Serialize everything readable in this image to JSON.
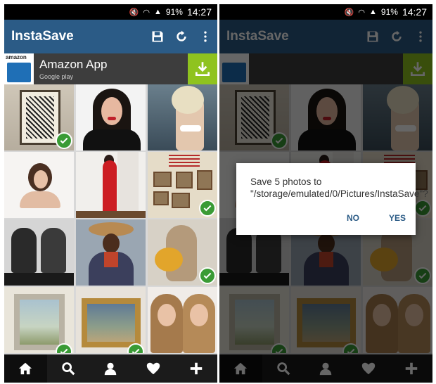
{
  "status_bar": {
    "battery": "91%",
    "time": "14:27"
  },
  "app": {
    "title": "InstaSave"
  },
  "ad": {
    "name": "Amazon App",
    "store": "Google play",
    "logo_text": "amazon"
  },
  "colors": {
    "app_bar": "#2b5b86",
    "check": "#3a9b35",
    "download": "#8fc31f",
    "nav": "#1b1b1b"
  },
  "icons": {
    "toolbar": [
      "save-icon",
      "refresh-icon",
      "more-vert-icon"
    ],
    "nav": [
      "home-icon",
      "search-icon",
      "profile-icon",
      "heart-icon",
      "plus-icon"
    ]
  },
  "grid": {
    "photos": [
      {
        "subject": "framed artwork",
        "selected": true
      },
      {
        "subject": "woman in leather jacket",
        "selected": false
      },
      {
        "subject": "blonde woman at beach",
        "selected": false
      },
      {
        "subject": "woman portrait white",
        "selected": false
      },
      {
        "subject": "woman in red dress",
        "selected": false
      },
      {
        "subject": "gallery wall",
        "selected": true
      },
      {
        "subject": "two DJs",
        "selected": false
      },
      {
        "subject": "painting of man with hat",
        "selected": false
      },
      {
        "subject": "kangaroo with ball",
        "selected": true
      },
      {
        "subject": "watercolor frame",
        "selected": true
      },
      {
        "subject": "gold frame painting",
        "selected": true
      },
      {
        "subject": "twins portrait",
        "selected": false
      }
    ]
  },
  "gallery_wall": {
    "text": "A CITY WITHOUT ART IS A CITY WITHOUT A HEART"
  },
  "dialog": {
    "message": "Save 5 photos to \"/storage/emulated/0/Pictures/InstaSave\"?",
    "no_label": "NO",
    "yes_label": "YES"
  }
}
